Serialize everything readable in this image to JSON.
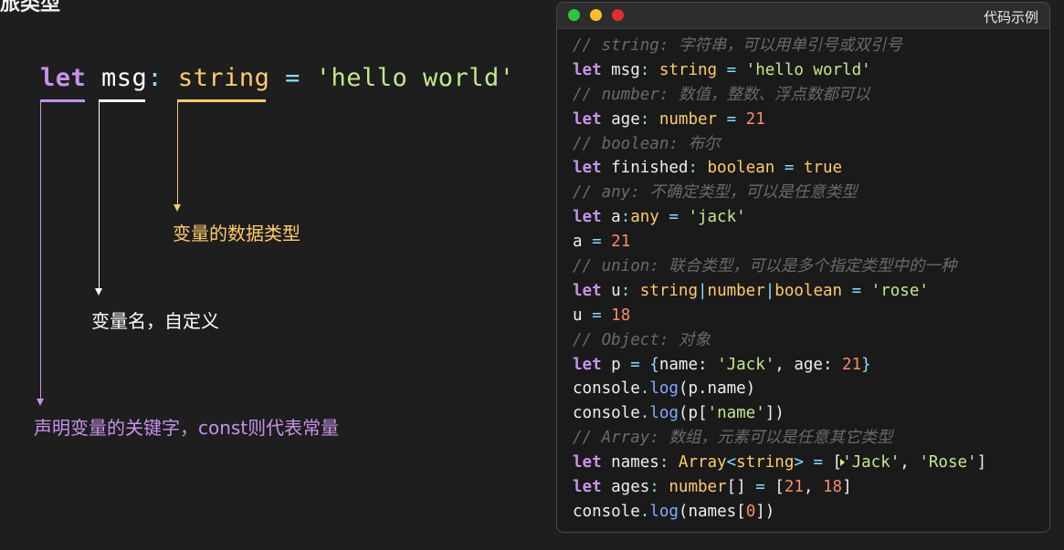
{
  "top_fragment": "旅类型",
  "diagram": {
    "kw": "let",
    "name": "msg",
    "colon": ":",
    "type": "string",
    "eq": "=",
    "value": "'hello world'",
    "type_label": "变量的数据类型",
    "name_label": "变量名，自定义",
    "kw_label": "声明变量的关键字，const则代表常量",
    "colors": {
      "keyword": "#c792ea",
      "name": "#ffffff",
      "type": "#ffcb6b",
      "string": "#c3e88d"
    }
  },
  "window": {
    "title": "代码示例",
    "dot_colors": [
      "#28c840",
      "#febc2e",
      "#e02e2e"
    ]
  },
  "code": {
    "l1": "// string: 字符串，可以用单引号或双引号",
    "l2": {
      "kw": "let",
      "a": " msg",
      "b": ": ",
      "ty": "string",
      "c": " = ",
      "str": "'hello world'"
    },
    "l3": "// number: 数值，整数、浮点数都可以",
    "l4": {
      "kw": "let",
      "a": " age",
      "b": ": ",
      "ty": "number",
      "c": " = ",
      "num": "21"
    },
    "l5": "// boolean: 布尔",
    "l6": {
      "kw": "let",
      "a": " finished",
      "b": ": ",
      "ty": "boolean",
      "c": " = ",
      "val": "true"
    },
    "l7": "// any: 不确定类型，可以是任意类型",
    "l8": {
      "kw": "let",
      "a": " a",
      "b": ":",
      "ty": "any",
      "c": " = ",
      "str": "'jack'"
    },
    "l9": {
      "a": "a",
      "c": " = ",
      "num": "21"
    },
    "l10": "// union: 联合类型，可以是多个指定类型中的一种",
    "l11": {
      "kw": "let",
      "a": " u",
      "b": ": ",
      "t1": "string",
      "p1": "|",
      "t2": "number",
      "p2": "|",
      "t3": "boolean",
      "c": " = ",
      "str": "'rose'"
    },
    "l12": {
      "a": "u",
      "c": " = ",
      "num": "18"
    },
    "l13": "// Object: 对象",
    "l14": {
      "kw": "let",
      "a": " p",
      "c": " = ",
      "o": "{",
      "k1": "name: ",
      "s1": "'Jack'",
      "cm": ", ",
      "k2": "age: ",
      "n1": "21",
      "e": "}"
    },
    "l15": {
      "obj": "console",
      "dot": ".",
      "fn": "log",
      "rest": "(p.name)"
    },
    "l16": {
      "obj": "console",
      "dot": ".",
      "fn": "log",
      "r1": "(p[",
      "s": "'name'",
      "r2": "])"
    },
    "l17": "// Array: 数组，元素可以是任意其它类型",
    "l18": {
      "kw": "let",
      "a": " names",
      "b": ": ",
      "ty": "Array",
      "lt": "<",
      "ty2": "string",
      "gt": ">",
      "c": " = ",
      "o": "[",
      "s1": "'Jack'",
      "cm": ", ",
      "s2": "'Rose'",
      "e": "]"
    },
    "l19": {
      "kw": "let",
      "a": " ages",
      "b": ": ",
      "ty": "number",
      "br": "[]",
      "c": " = ",
      "o": "[",
      "n1": "21",
      "cm": ", ",
      "n2": "18",
      "e": "]"
    },
    "l20": {
      "obj": "console",
      "dot": ".",
      "fn": "log",
      "r1": "(names[",
      "n": "0",
      "r2": "])"
    }
  }
}
